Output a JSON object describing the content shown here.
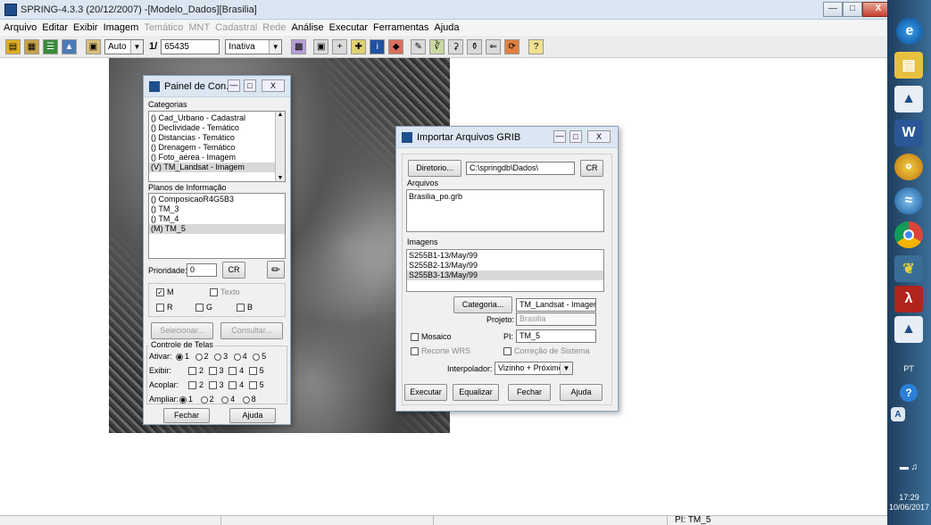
{
  "window": {
    "title": "SPRING-4.3.3 (20/12/2007) -[Modelo_Dados][Brasilia]",
    "min": "—",
    "max": "□",
    "close": "X"
  },
  "menu": [
    {
      "label": "Arquivo",
      "enabled": true
    },
    {
      "label": "Editar",
      "enabled": true
    },
    {
      "label": "Exibir",
      "enabled": true
    },
    {
      "label": "Imagem",
      "enabled": true
    },
    {
      "label": "Temático",
      "enabled": false
    },
    {
      "label": "MNT",
      "enabled": false
    },
    {
      "label": "Cadastral",
      "enabled": false
    },
    {
      "label": "Rede",
      "enabled": false
    },
    {
      "label": "Análise",
      "enabled": true
    },
    {
      "label": "Executar",
      "enabled": true
    },
    {
      "label": "Ferramentas",
      "enabled": true
    },
    {
      "label": "Ajuda",
      "enabled": true
    }
  ],
  "toolbar": {
    "zoom_mode": "Auto",
    "scale_prefix": "1/",
    "scale_value": "65435",
    "state": "Inativa"
  },
  "painel": {
    "title": "Painel de Con...",
    "categorias_label": "Categorias",
    "categorias": [
      "() Cad_Urbano - Cadastral",
      "() Declividade - Temático",
      "() Distancias - Temático",
      "() Drenagem - Temático",
      "() Foto_aérea - Imagem",
      "(V) TM_Landsat - Imagem"
    ],
    "planos_label": "Planos de Informação",
    "planos": [
      "() ComposicaoR4G5B3",
      "() TM_3",
      "() TM_4",
      "(M) TM_5"
    ],
    "prioridade_label": "Prioridade:",
    "prioridade_value": "0",
    "cr_button": "CR",
    "check_m": "M",
    "check_texto": "Texto",
    "check_r": "R",
    "check_g": "G",
    "check_b": "B",
    "selecionar": "Selecionar...",
    "consultar": "Consultar...",
    "controle_label": "Controle de Telas",
    "ativar_label": "Ativar:",
    "exibir_label": "Exibir:",
    "acoplar_label": "Acoplar:",
    "ampliar_label": "Ampliar:",
    "n1": "1",
    "n2": "2",
    "n3": "3",
    "n4": "4",
    "n5": "5",
    "n8": "8",
    "fechar": "Fechar",
    "ajuda": "Ajuda"
  },
  "grib": {
    "title": "Importar Arquivos GRIB",
    "diretorio_button": "Diretorio...",
    "diretorio_value": "C:\\springdb\\Dados\\",
    "cr_button": "CR",
    "arquivos_label": "Arquivos",
    "arquivos": [
      "Brasilia_po.grb"
    ],
    "imagens_label": "Imagens",
    "imagens": [
      "S255B1-13/May/99",
      "S255B2-13/May/99",
      "S255B3-13/May/99"
    ],
    "categoria_button": "Categoria...",
    "categoria_value": "TM_Landsat - Imagem",
    "projeto_label": "Projeto:",
    "projeto_value": "Brasilia",
    "mosaico_label": "Mosaico",
    "pi_label": "PI:",
    "pi_value": "TM_5",
    "recorte_label": "Recorte WRS",
    "correcao_label": "Correção de Sistema",
    "interpolador_label": "Interpolador:",
    "interpolador_value": "Vizinho + Próximo",
    "executar": "Executar",
    "equalizar": "Equalizar",
    "fechar": "Fechar",
    "ajuda": "Ajuda"
  },
  "status": {
    "pi": "PI: TM_5"
  },
  "taskbar": {
    "lang": "PT",
    "time": "17:29",
    "date": "10/06/2017",
    "icons": [
      "ie-icon",
      "folder-icon",
      "spring-icon",
      "word-icon",
      "network-icon",
      "google-earth-icon",
      "chrome-icon",
      "spring2-icon",
      "acrobat-icon",
      "spring3-icon"
    ]
  }
}
